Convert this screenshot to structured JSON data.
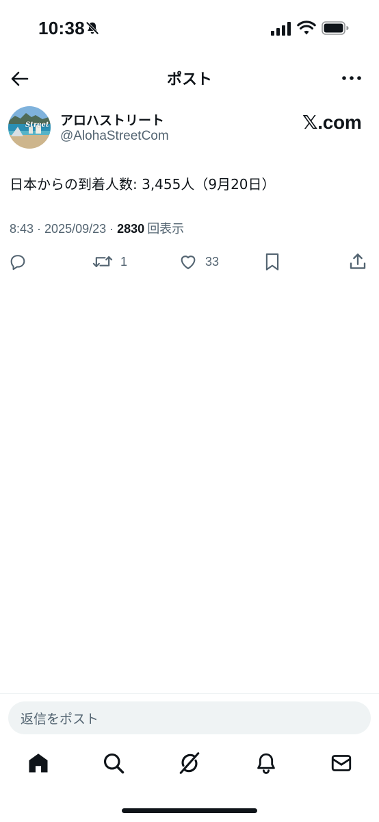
{
  "status_bar": {
    "time": "10:38"
  },
  "header": {
    "title": "ポスト"
  },
  "post": {
    "author_name": "アロハストリート",
    "author_handle": "@AlohaStreetCom",
    "avatar_text": "Street",
    "badge_text": ".com",
    "text": "日本からの到着人数: 3,455人（9月20日）",
    "time": "8:43",
    "separator": " · ",
    "date": "2025/09/23",
    "views_count": "2830",
    "views_label": "回表示"
  },
  "actions": {
    "reply_count": "",
    "repost_count": "1",
    "like_count": "33"
  },
  "reply_bar": {
    "placeholder": "返信をポスト"
  },
  "icons": {
    "back": "arrow-left-icon",
    "more": "more-horizontal-icon",
    "reply": "comment-icon",
    "repost": "repost-icon",
    "like": "heart-icon",
    "bookmark": "bookmark-icon",
    "share": "share-icon",
    "home": "home-icon",
    "search": "search-icon",
    "grok": "grok-icon",
    "notifications": "bell-icon",
    "messages": "mail-icon"
  },
  "colors": {
    "text_primary": "#0f1419",
    "text_secondary": "#536471",
    "reply_bar_bg": "#eff3f4"
  }
}
